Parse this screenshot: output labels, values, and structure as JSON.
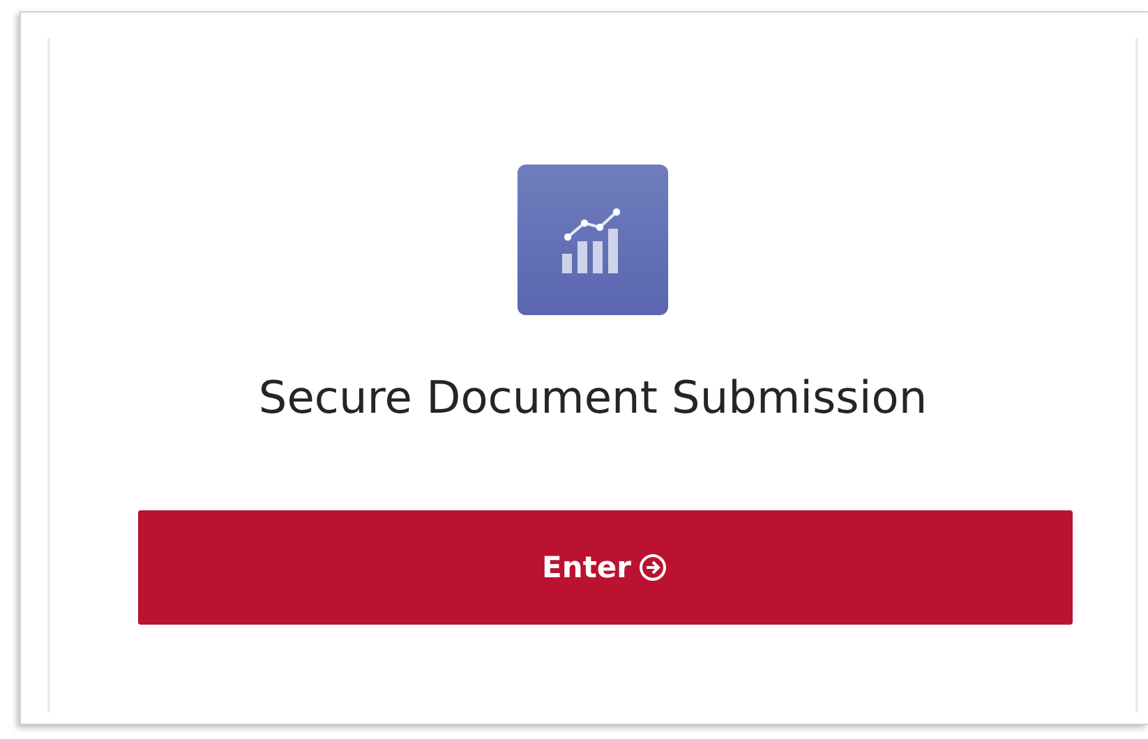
{
  "title": "Secure Document Submission",
  "button": {
    "label": "Enter"
  }
}
